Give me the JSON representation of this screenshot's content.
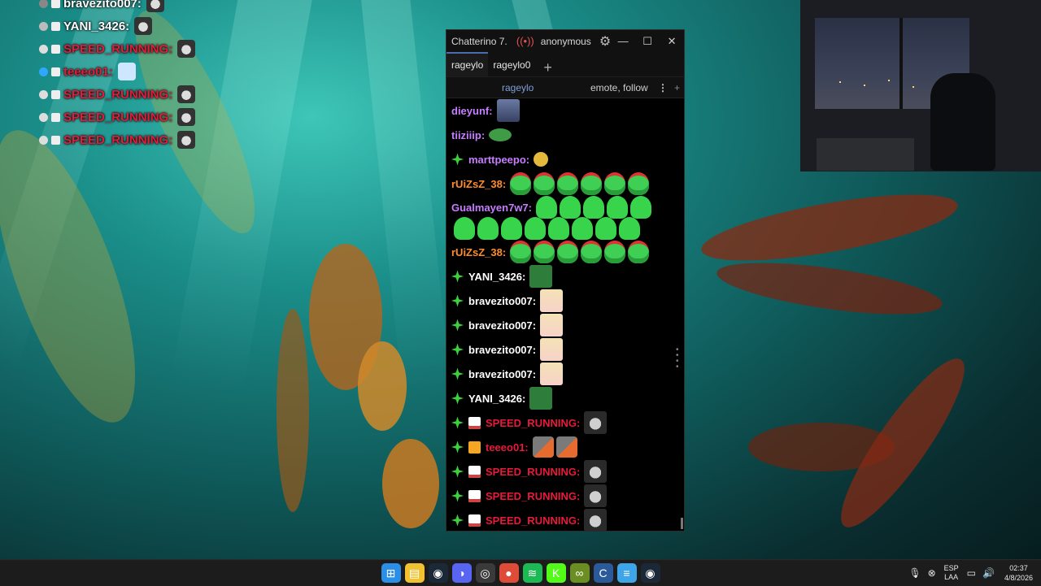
{
  "overlay_chat": [
    {
      "user": "bravezito007:",
      "color": "#ffffff",
      "badge": "#888888",
      "emote": "anime-emote"
    },
    {
      "user": "YANI_3426:",
      "color": "#ffffff",
      "badge": "#bbbbbb",
      "emote": "frog-emote"
    },
    {
      "user": "SPEED_RUNNING:",
      "color": "#e81a3a",
      "badge": "#dddddd",
      "emote": "pug-emote"
    },
    {
      "user": "teeeo01:",
      "color": "#e81a3a",
      "badge": "#30a7ff",
      "emote": "ghost-emote"
    },
    {
      "user": "SPEED_RUNNING:",
      "color": "#e81a3a",
      "badge": "#dddddd",
      "emote": "pug-emote"
    },
    {
      "user": "SPEED_RUNNING:",
      "color": "#e81a3a",
      "badge": "#dddddd",
      "emote": "pug-emote"
    },
    {
      "user": "SPEED_RUNNING:",
      "color": "#e81a3a",
      "badge": "#dddddd",
      "emote": "pug-emote"
    }
  ],
  "window": {
    "app_title": "Chatterino 7.",
    "live_icon": "live-icon",
    "account": "anonymous",
    "minimize": "—",
    "maximize": "☐",
    "close": "✕"
  },
  "tabs": [
    {
      "label": "rageylo",
      "active": true
    },
    {
      "label": "rageylo0",
      "active": false
    }
  ],
  "tab_add": "+",
  "split_header": {
    "channel": "rageylo",
    "mode": "emote, follow",
    "menu": "⋮",
    "add": "+"
  },
  "messages": [
    {
      "user": "dieyunf:",
      "color": "#c77dff",
      "badge": null,
      "emotes": [
        "face"
      ]
    },
    {
      "user": "tiiziiip:",
      "color": "#c77dff",
      "badge": null,
      "emotes": [
        "frog"
      ]
    },
    {
      "user": "marttpeepo:",
      "color": "#c77dff",
      "badge": "star",
      "emotes": [
        "coin"
      ]
    },
    {
      "user": "rUiZsZ_38:",
      "color": "#ff8c2a",
      "badge": null,
      "emotes": [
        "horn",
        "horn",
        "horn",
        "horn",
        "horn",
        "horn"
      ]
    },
    {
      "user": "Gualmayen7w7:",
      "color": "#c77dff",
      "badge": null,
      "emotes": [
        "ghost",
        "ghost",
        "ghost",
        "ghost",
        "ghost"
      ],
      "wrap": [
        "ghost",
        "ghost",
        "ghost",
        "ghost",
        "ghost",
        "ghost",
        "ghost",
        "ghost"
      ]
    },
    {
      "user": "rUiZsZ_38:",
      "color": "#ff8c2a",
      "badge": null,
      "emotes": [
        "horn",
        "horn",
        "horn",
        "horn",
        "horn",
        "horn"
      ]
    },
    {
      "user": "YANI_3426:",
      "color": "#ffffff",
      "badge": "star",
      "emotes": [
        "pepe"
      ]
    },
    {
      "user": "bravezito007:",
      "color": "#ffffff",
      "badge": "star",
      "emotes": [
        "anime"
      ]
    },
    {
      "user": "bravezito007:",
      "color": "#ffffff",
      "badge": "star",
      "emotes": [
        "anime"
      ]
    },
    {
      "user": "bravezito007:",
      "color": "#ffffff",
      "badge": "star",
      "emotes": [
        "anime"
      ]
    },
    {
      "user": "bravezito007:",
      "color": "#ffffff",
      "badge": "star",
      "emotes": [
        "anime"
      ]
    },
    {
      "user": "YANI_3426:",
      "color": "#ffffff",
      "badge": "star",
      "emotes": [
        "pepe"
      ]
    },
    {
      "user": "SPEED_RUNNING:",
      "color": "#e81a3a",
      "badge": "star",
      "badge2": "mail",
      "emotes": [
        "pug"
      ]
    },
    {
      "user": "teeeo01:",
      "color": "#e81a3a",
      "badge": "star",
      "badge2": "box",
      "emotes": [
        "stonks",
        "stonks"
      ]
    },
    {
      "user": "SPEED_RUNNING:",
      "color": "#e81a3a",
      "badge": "star",
      "badge2": "mail",
      "emotes": [
        "pug"
      ]
    },
    {
      "user": "SPEED_RUNNING:",
      "color": "#e81a3a",
      "badge": "star",
      "badge2": "mail",
      "emotes": [
        "pug"
      ]
    },
    {
      "user": "SPEED_RUNNING:",
      "color": "#e81a3a",
      "badge": "star",
      "badge2": "mail",
      "emotes": [
        "pug"
      ]
    }
  ],
  "taskbar": {
    "icons": [
      {
        "name": "start-icon",
        "color": "#2b8fe8",
        "glyph": "⊞"
      },
      {
        "name": "file-explorer-icon",
        "color": "#f2c230",
        "glyph": "▤"
      },
      {
        "name": "steam-icon",
        "color": "#1b2838",
        "glyph": "◉"
      },
      {
        "name": "discord-icon",
        "color": "#5865f2",
        "glyph": "◑"
      },
      {
        "name": "obs-icon",
        "color": "#3a3a3a",
        "glyph": "◎"
      },
      {
        "name": "chrome-icon",
        "color": "#dd4b39",
        "glyph": "●"
      },
      {
        "name": "spotify-icon",
        "color": "#1db954",
        "glyph": "≋"
      },
      {
        "name": "kick-icon",
        "color": "#53fc18",
        "glyph": "K"
      },
      {
        "name": "game-icon",
        "color": "#6b8e23",
        "glyph": "∞"
      },
      {
        "name": "chatterino-icon",
        "color": "#2a5a9a",
        "glyph": "C"
      },
      {
        "name": "notepad-icon",
        "color": "#3ea6e8",
        "glyph": "≡"
      },
      {
        "name": "steam-icon-2",
        "color": "#1b2838",
        "glyph": "◉"
      }
    ],
    "lang_top": "ESP",
    "lang_bottom": "LAA",
    "time": "02:37",
    "date": "4/8/2026"
  }
}
